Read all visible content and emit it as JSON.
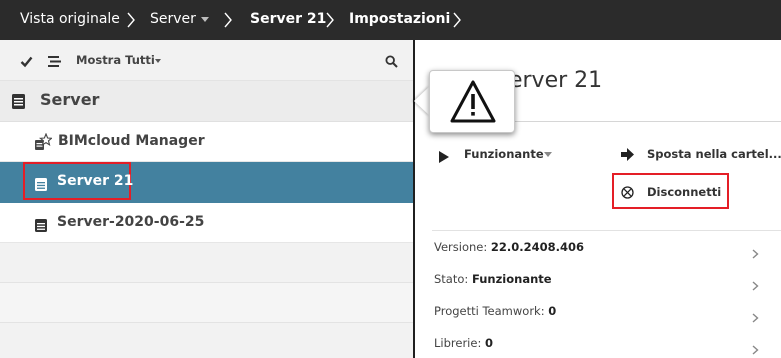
{
  "breadcrumb": {
    "items": [
      {
        "label": "Vista originale"
      },
      {
        "label": "Server"
      },
      {
        "label": "Server 21"
      },
      {
        "label": "Impostazioni"
      }
    ]
  },
  "left_panel": {
    "toolbar": {
      "check_icon": "checkmark-icon",
      "list_icon": "list-icon",
      "filter_label": "Mostra Tutti",
      "search_icon": "search-icon"
    },
    "tree": {
      "root_label": "Server",
      "items": [
        {
          "label": "BIMcloud Manager",
          "icon": "manager-star-icon"
        },
        {
          "label": "Server 21",
          "icon": "server-icon",
          "selected": true
        },
        {
          "label": "Server-2020-06-25",
          "icon": "server-icon"
        }
      ]
    }
  },
  "right_panel": {
    "title": "Server 21",
    "actions": {
      "status_label": "Funzionante",
      "move_label": "Sposta nella cartel...",
      "disconnect_label": "Disconnetti"
    },
    "info": [
      {
        "label": "Versione:",
        "value": "22.0.2408.406"
      },
      {
        "label": "Stato:",
        "value": "Funzionante"
      },
      {
        "label": "Progetti Teamwork:",
        "value": "0"
      },
      {
        "label": "Librerie:",
        "value": "0"
      }
    ]
  },
  "popup": {
    "icon": "warning-icon"
  },
  "colors": {
    "topbar": "#2b2b2b",
    "selected_row": "#43819f",
    "highlight": "#e41e26"
  }
}
